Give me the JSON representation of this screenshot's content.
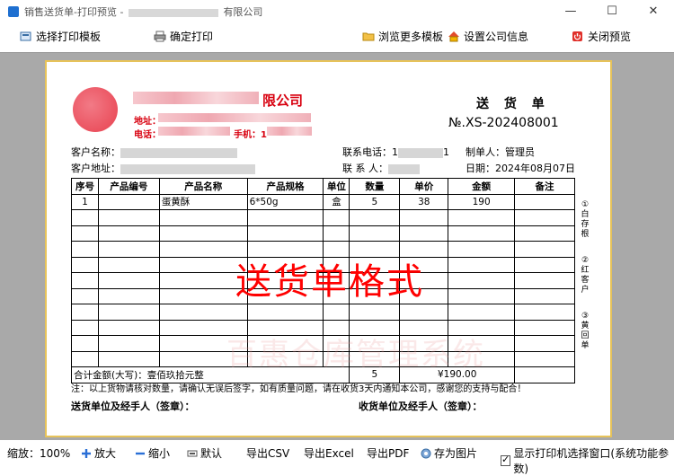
{
  "window": {
    "title_prefix": "销售送货单-打印预览 -",
    "title_suffix": "有限公司",
    "min": "—",
    "max": "☐",
    "close": "✕"
  },
  "toolbar": {
    "select_template": "选择打印模板",
    "confirm_print": "确定打印",
    "browse_templates": "浏览更多模板",
    "company_info": "设置公司信息",
    "close_preview": "关闭预览"
  },
  "doc": {
    "company_name": "限公司",
    "address_label": "地址：",
    "phone_label": "电话：",
    "mobile_label": "手机：",
    "mobile_value": "1",
    "title": "送 货 单",
    "number": "№.XS-202408001",
    "customer_name_label": "客户名称：",
    "customer_addr_label": "客户地址：",
    "contact_phone_label": "联系电话：",
    "contact_phone_value": "1",
    "contact_phone_tail": "1",
    "contact_person_label": "联 系 人：",
    "maker_label": "制单人：",
    "maker": "管理员",
    "date_label": "日期：",
    "date": "2024年08月07日",
    "columns": [
      "序号",
      "产品编号",
      "产品名称",
      "产品规格",
      "单位",
      "数量",
      "单价",
      "金额",
      "备注"
    ],
    "rows": [
      {
        "no": "1",
        "code": "",
        "name": "蛋黄酥",
        "spec": "6*50g",
        "unit": "盒",
        "qty": "5",
        "price": "38",
        "amount": "190",
        "note": ""
      }
    ],
    "total_label": "合计金额(大写)：壹佰玖拾元整",
    "total_qty": "5",
    "total_amount": "¥190.00",
    "side_notes": [
      "①",
      "白",
      "存",
      "根",
      "②",
      "红",
      "客",
      "户",
      "③",
      "黄",
      "回",
      "单"
    ],
    "stamp": "送货单格式",
    "watermark": "百惠仓库管理系统",
    "note": "注：以上货物请核对数量，请确认无误后签字，如有质量问题，请在收货3天内通知本公司，感谢您的支持与配合！",
    "sign_sender": "送货单位及经手人（签章）：",
    "sign_receiver": "收货单位及经手人（签章）："
  },
  "statusbar": {
    "zoom_label": "缩放：",
    "zoom": "100%",
    "zoom_in": "放大",
    "zoom_out": "缩小",
    "default": "默认",
    "export_csv": "导出CSV",
    "export_excel": "导出Excel",
    "export_pdf": "导出PDF",
    "save_image": "存为图片",
    "show_printer": "显示打印机选择窗口(系统功能参数)"
  }
}
